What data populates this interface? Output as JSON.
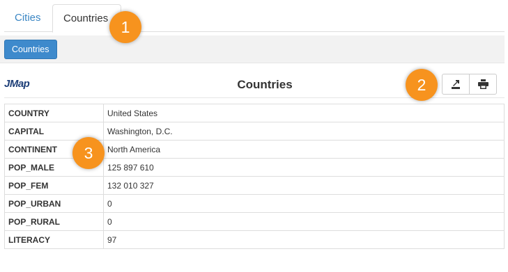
{
  "tabs": [
    {
      "label": "Cities",
      "active": false
    },
    {
      "label": "Countries",
      "active": true
    }
  ],
  "toolbar": {
    "button_label": "Countries"
  },
  "header": {
    "logo_text": "JMap",
    "title": "Countries"
  },
  "header_actions": {
    "export_icon": "export-icon",
    "print_icon": "printer-icon"
  },
  "table": {
    "rows": [
      {
        "key": "COUNTRY",
        "value": "United States"
      },
      {
        "key": "CAPITAL",
        "value": "Washington, D.C."
      },
      {
        "key": "CONTINENT",
        "value": "North America"
      },
      {
        "key": "POP_MALE",
        "value": "125 897 610"
      },
      {
        "key": "POP_FEM",
        "value": "132 010 327"
      },
      {
        "key": "POP_URBAN",
        "value": "0"
      },
      {
        "key": "POP_RURAL",
        "value": "0"
      },
      {
        "key": "LITERACY",
        "value": "97"
      }
    ]
  },
  "callouts": [
    "1",
    "2",
    "3"
  ],
  "colors": {
    "accent": "#3e8acc",
    "tab_link": "#3a86c4",
    "callout": "#f7931e",
    "logo": "#1e3f78"
  }
}
